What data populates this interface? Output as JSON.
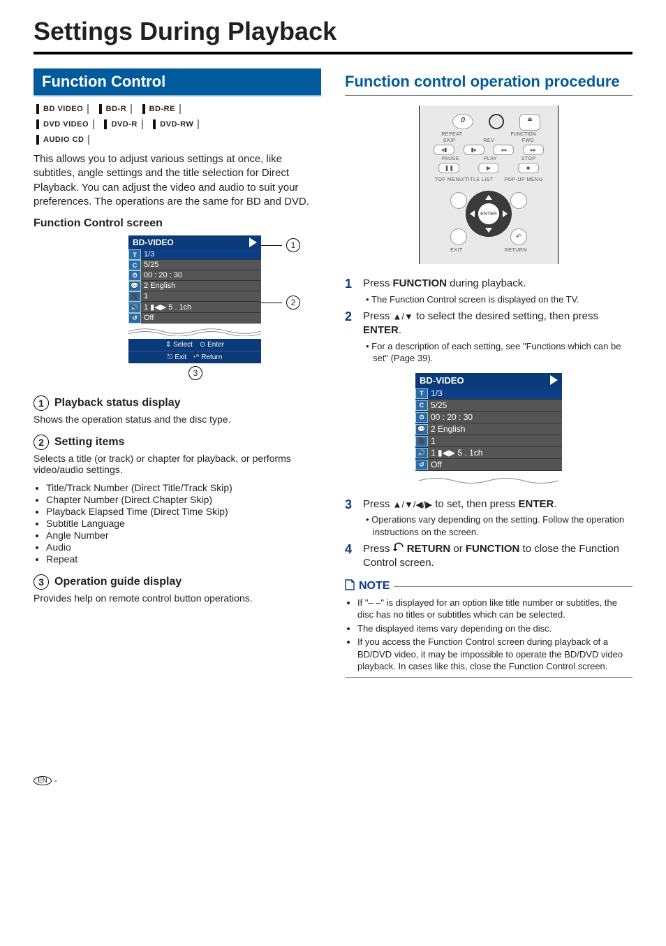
{
  "page_title": "Settings During Playback",
  "left": {
    "section_bar": "Function Control",
    "badges_row1": [
      "BD VIDEO",
      "BD-R",
      "BD-RE"
    ],
    "badges_row2": [
      "DVD VIDEO",
      "DVD-R",
      "DVD-RW"
    ],
    "badges_row3": [
      "AUDIO CD"
    ],
    "intro": "This allows you to adjust various settings at once, like subtitles, angle settings and the title selection for Direct Playback. You can adjust the video and audio to suit your preferences. The operations are the same for BD and DVD.",
    "fcs_heading": "Function Control screen",
    "fcs": {
      "header": "BD-VIDEO",
      "rows": [
        {
          "icon": "T",
          "value": "1/3"
        },
        {
          "icon": "C",
          "value": "5/25"
        },
        {
          "icon": "⏱",
          "value": "00 : 20 : 30"
        },
        {
          "icon": "💬",
          "value": "2 English"
        },
        {
          "icon": "🎥",
          "value": "1"
        },
        {
          "icon": "🔊",
          "value": "1   ▮◀▶   5 . 1ch"
        },
        {
          "icon": "↺",
          "value": "Off"
        }
      ],
      "guide": {
        "select": "Select",
        "enter": "Enter",
        "exit": "Exit",
        "return": "Return"
      },
      "callouts": [
        "1",
        "2",
        "3"
      ]
    },
    "item1_h": "Playback status display",
    "item1_t": "Shows the operation status and the disc type.",
    "item2_h": "Setting items",
    "item2_t": "Selects a title (or track) or chapter for playback, or performs video/audio settings.",
    "item2_list": [
      "Title/Track Number (Direct Title/Track Skip)",
      "Chapter Number (Direct Chapter Skip)",
      "Playback Elapsed Time (Direct Time Skip)",
      "Subtitle Language",
      "Angle Number",
      "Audio",
      "Repeat"
    ],
    "item3_h": "Operation guide display",
    "item3_t": "Provides help on remote control button operations."
  },
  "right": {
    "heading": "Function control operation procedure",
    "remote": {
      "row_labels_top": {
        "zero_btn": "0",
        "func": "FUNCTION",
        "repeat": "REPEAT",
        "rev": "REV",
        "fwd": "FWD",
        "skip": "SKIP",
        "pause": "PAUSE",
        "play": "PLAY",
        "stop": "STOP"
      },
      "row_labels_bottom": {
        "top_menu": "TOP MENU/TITLE LIST",
        "popup": "POP-UP MENU",
        "exit": "EXIT",
        "return": "RETURN",
        "enter": "ENTER"
      }
    },
    "steps": [
      {
        "n": "1",
        "text_pre": "Press ",
        "bold": "FUNCTION",
        "text_post": " during playback.",
        "subs": [
          "The Function Control screen is displayed on the TV."
        ]
      },
      {
        "n": "2",
        "text_pre": "Press ",
        "arrows": "▲/▼",
        "text_mid": " to select the desired setting, then press ",
        "bold": "ENTER",
        "text_post": ".",
        "subs": [
          "For a description of each setting, see \"Functions which can be set\" (Page 39)."
        ]
      },
      {
        "n": "3",
        "text_pre": "Press ",
        "arrows": "▲/▼/◀/▶",
        "text_mid": " to set, then press ",
        "bold": "ENTER",
        "text_post": ".",
        "subs": [
          "Operations vary depending on the setting. Follow the operation instructions on the screen."
        ]
      },
      {
        "n": "4",
        "text_pre": "Press  ",
        "bold": "RETURN",
        "text_mid": " or ",
        "bold2": "FUNCTION",
        "text_post": " to close the Function Control screen.",
        "subs": []
      }
    ],
    "note_label": "NOTE",
    "notes": [
      "If \"– –\" is displayed for an option like title number or subtitles, the disc has no titles or subtitles which can be selected.",
      "The displayed items vary depending on the disc.",
      "If you access the Function Control screen during playback of a BD/DVD video, it may be impossible to operate the BD/DVD video playback. In cases like this, close the Function Control screen."
    ]
  },
  "footer": {
    "lang": "EN",
    "dash": " -"
  }
}
